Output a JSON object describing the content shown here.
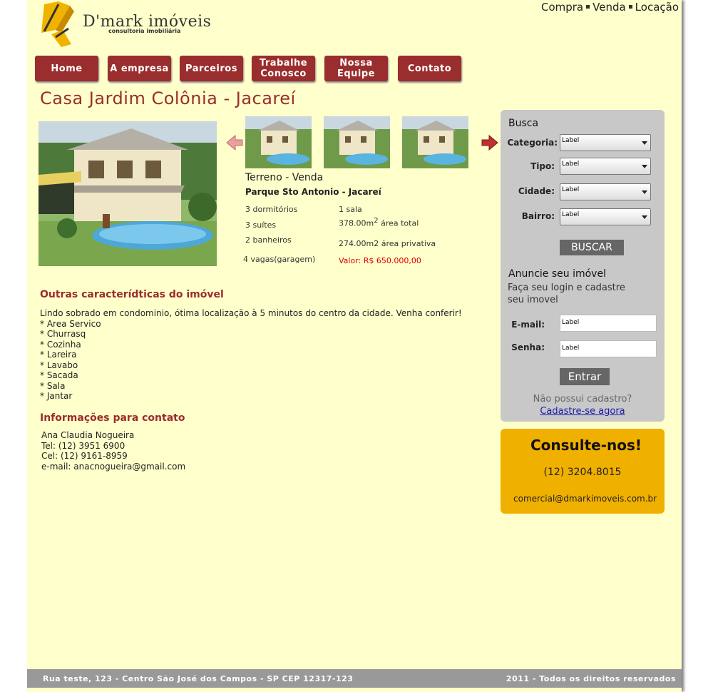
{
  "logo": {
    "brand": "D'mark imóveis",
    "tagline": "consultoria imobiliária"
  },
  "top_nav": [
    "Compra",
    "Venda",
    "Locação"
  ],
  "menu": [
    "Home",
    "A empresa",
    "Parceiros",
    "Trabalhe\nConosco",
    "Nossa\nEquipe",
    "Contato"
  ],
  "page_title": "Casa Jardim Colônia - Jacareí",
  "property": {
    "type": "Terreno - Venda",
    "neighborhood": "Parque Sto Antonio - Jacareí",
    "specs_left": [
      "3 dormitórios",
      "3 suítes",
      "2 banheiros",
      "4 vagas(garagem)"
    ],
    "specs_right": [
      "1 sala",
      "378.00m",
      "área total",
      "274.00m2 área privativa"
    ],
    "superscript": "2",
    "price": "Valor: R$ 650.000,00"
  },
  "features": {
    "heading": "Outras caracterídticas do imóvel",
    "lines": [
      "Lindo sobrado em condominio, ótima localização à 5 minutos do centro da cidade. Venha conferir!",
      "* Area Servico",
      "* Churrasq",
      "* Cozinha",
      "* Lareira",
      "* Lavabo",
      "* Sacada",
      "* Sala",
      "* Jantar"
    ]
  },
  "contact": {
    "heading": "Informações para contato",
    "lines": [
      "Ana Claudia Nogueira",
      "Tel: (12) 3951 6900",
      "Cel: (12) 9161-8959",
      "e-mail: anacnogueira@gmail.com"
    ]
  },
  "search": {
    "heading": "Busca",
    "fields": [
      {
        "label": "Categoria:",
        "value": "Label"
      },
      {
        "label": "Tipo:",
        "value": "Label"
      },
      {
        "label": "Cidade:",
        "value": "Label"
      },
      {
        "label": "Bairro:",
        "value": "Label"
      }
    ],
    "button": "BUSCAR"
  },
  "login": {
    "heading": "Anuncie seu imóvel",
    "subtext_1": "Faça seu login e cadastre",
    "subtext_2": "seu imovel",
    "email_label": "E-mail:",
    "email_value": "Label",
    "password_label": "Senha:",
    "password_value": "Label",
    "button": "Entrar",
    "no_account": "Não possui cadastro?",
    "register_link": "Cadastre-se agora"
  },
  "consult": {
    "heading": "Consulte-nos!",
    "phone": "(12) 3204.8015",
    "email": "comercial@dmarkimoveis.com.br"
  },
  "footer": {
    "address": "Rua teste, 123 - Centro São José dos Campos - SP CEP 12317-123",
    "copyright": "2011 - Todos os direitos reservados"
  },
  "colors": {
    "brand_red": "#9a2d2d",
    "background": "#ffffcc",
    "sidebar_gray": "#c8c8c8",
    "consult_yellow": "#f0b000",
    "price_red": "#e00000",
    "logo_yellow": "#f0b400"
  },
  "icons": [
    "logo-mark-icon",
    "arrow-left-icon",
    "arrow-right-icon"
  ]
}
